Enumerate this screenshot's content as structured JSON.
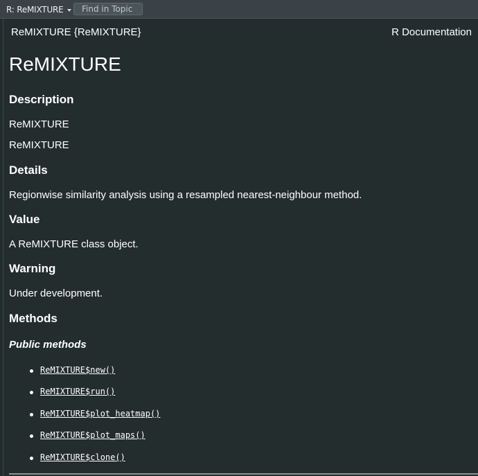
{
  "toolbar": {
    "topic_label": "R: ReMIXTURE",
    "find_placeholder": "Find in Topic"
  },
  "help": {
    "package_label": "ReMIXTURE {ReMIXTURE}",
    "rdoc_label": "R Documentation",
    "title": "ReMIXTURE",
    "sections": {
      "description_heading": "Description",
      "description_line1": "ReMIXTURE",
      "description_line2": "ReMIXTURE",
      "details_heading": "Details",
      "details_text": "Regionwise similarity analysis using a resampled nearest-neighbour method.",
      "value_heading": "Value",
      "value_text": "A ReMIXTURE class object.",
      "warning_heading": "Warning",
      "warning_text": "Under development.",
      "methods_heading": "Methods",
      "public_methods_heading": "Public methods"
    },
    "methods": [
      "ReMIXTURE$new()",
      "ReMIXTURE$run()",
      "ReMIXTURE$plot_heatmap()",
      "ReMIXTURE$plot_maps()",
      "ReMIXTURE$clone()"
    ]
  },
  "colors": {
    "background": "#232b2b",
    "toolbar": "#3a4248",
    "text": "#ffffff"
  }
}
